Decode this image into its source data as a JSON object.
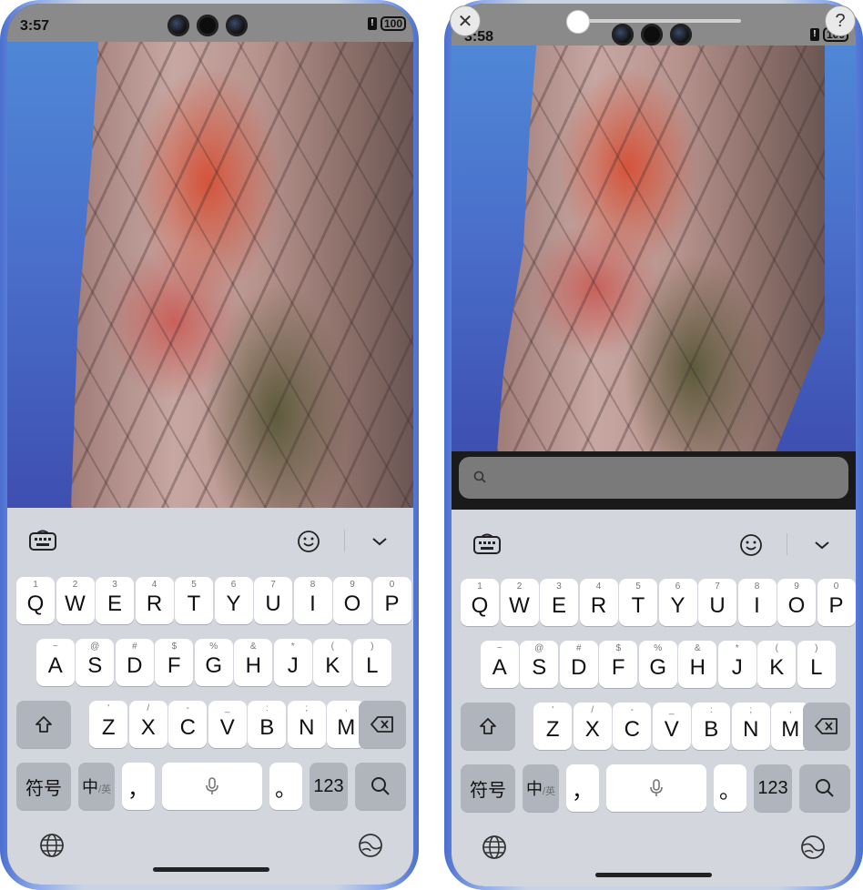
{
  "left_phone": {
    "status": {
      "time": "3:57",
      "battery": "100"
    }
  },
  "right_phone": {
    "status": {
      "time": "3:58",
      "battery": "100"
    },
    "close_label": "✕",
    "help_label": "?"
  },
  "keyboard": {
    "row1": [
      {
        "sup": "1",
        "main": "Q"
      },
      {
        "sup": "2",
        "main": "W"
      },
      {
        "sup": "3",
        "main": "E"
      },
      {
        "sup": "4",
        "main": "R"
      },
      {
        "sup": "5",
        "main": "T"
      },
      {
        "sup": "6",
        "main": "Y"
      },
      {
        "sup": "7",
        "main": "U"
      },
      {
        "sup": "8",
        "main": "I"
      },
      {
        "sup": "9",
        "main": "O"
      },
      {
        "sup": "0",
        "main": "P"
      }
    ],
    "row2": [
      {
        "sup": "~",
        "main": "A"
      },
      {
        "sup": "@",
        "main": "S"
      },
      {
        "sup": "#",
        "main": "D"
      },
      {
        "sup": "$",
        "main": "F"
      },
      {
        "sup": "%",
        "main": "G"
      },
      {
        "sup": "&",
        "main": "H"
      },
      {
        "sup": "*",
        "main": "J"
      },
      {
        "sup": "(",
        "main": "K"
      },
      {
        "sup": ")",
        "main": "L"
      }
    ],
    "row3": [
      {
        "sup": "'",
        "main": "Z"
      },
      {
        "sup": "/",
        "main": "X"
      },
      {
        "sup": "-",
        "main": "C"
      },
      {
        "sup": "_",
        "main": "V"
      },
      {
        "sup": ":",
        "main": "B"
      },
      {
        "sup": ";",
        "main": "N"
      },
      {
        "sup": ",",
        "main": "M"
      }
    ],
    "symbols_label": "符号",
    "zh_label": "中",
    "en_label": "/英",
    "comma_label": "，",
    "period_label": "。",
    "numbers_label": "123",
    "icons": {
      "keyboard": "keyboard-icon",
      "emoji": "emoji-icon",
      "collapse": "chevron-down-icon",
      "shift": "shift-icon",
      "backspace": "backspace-icon",
      "mic": "microphone-icon",
      "search": "search-icon",
      "globe": "globe-icon",
      "theme": "theme-icon"
    }
  }
}
